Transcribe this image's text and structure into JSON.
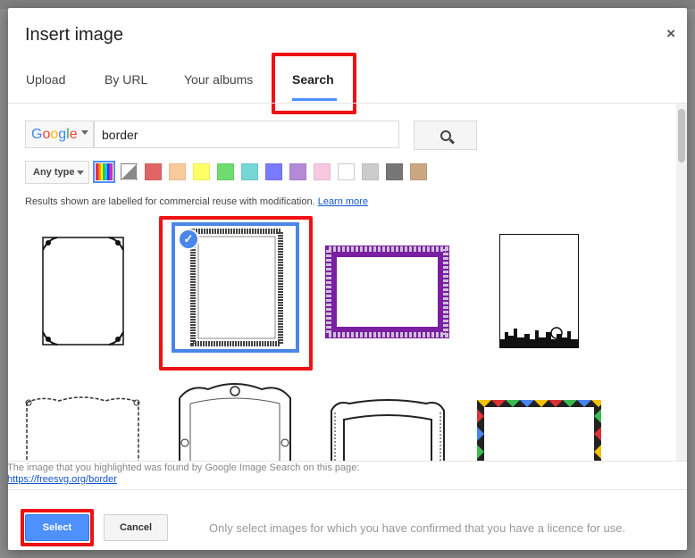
{
  "dialog": {
    "title": "Insert image",
    "close_label": "×"
  },
  "tabs": [
    {
      "label": "Upload"
    },
    {
      "label": "By URL"
    },
    {
      "label": "Your albums"
    },
    {
      "label": "Search",
      "active": true
    }
  ],
  "search": {
    "engine_logo": "Google",
    "query": "border",
    "button_icon": "search-icon"
  },
  "filters": {
    "type_label": "Any type",
    "colors": [
      "multicolor",
      "transparent",
      "#e06666",
      "#f9cb9c",
      "#ffff66",
      "#6fdc6f",
      "#76d7d7",
      "#7a7aff",
      "#b48ad6",
      "#f7c8e0",
      "#ffffff",
      "#cccccc",
      "#777777",
      "#c9a882"
    ]
  },
  "license_note": {
    "text": "Results shown are labelled for commercial reuse with modification.",
    "link": "Learn more"
  },
  "results": [
    {
      "name": "ornate-corner-border"
    },
    {
      "name": "dark-chain-border",
      "selected": true
    },
    {
      "name": "purple-lace-border"
    },
    {
      "name": "skyline-border"
    },
    {
      "name": "scroll-border"
    },
    {
      "name": "baroque-border"
    },
    {
      "name": "engraved-border"
    },
    {
      "name": "triangle-border"
    }
  ],
  "found": {
    "text": "The image that you highlighted was found by Google Image Search on this page:",
    "link": "https://freesvg.org/border"
  },
  "footer": {
    "select_label": "Select",
    "cancel_label": "Cancel",
    "message": "Only select images for which you have confirmed that you have a licence for use."
  },
  "colors": {
    "accent": "#4d90fe",
    "highlight": "#ee1111"
  }
}
